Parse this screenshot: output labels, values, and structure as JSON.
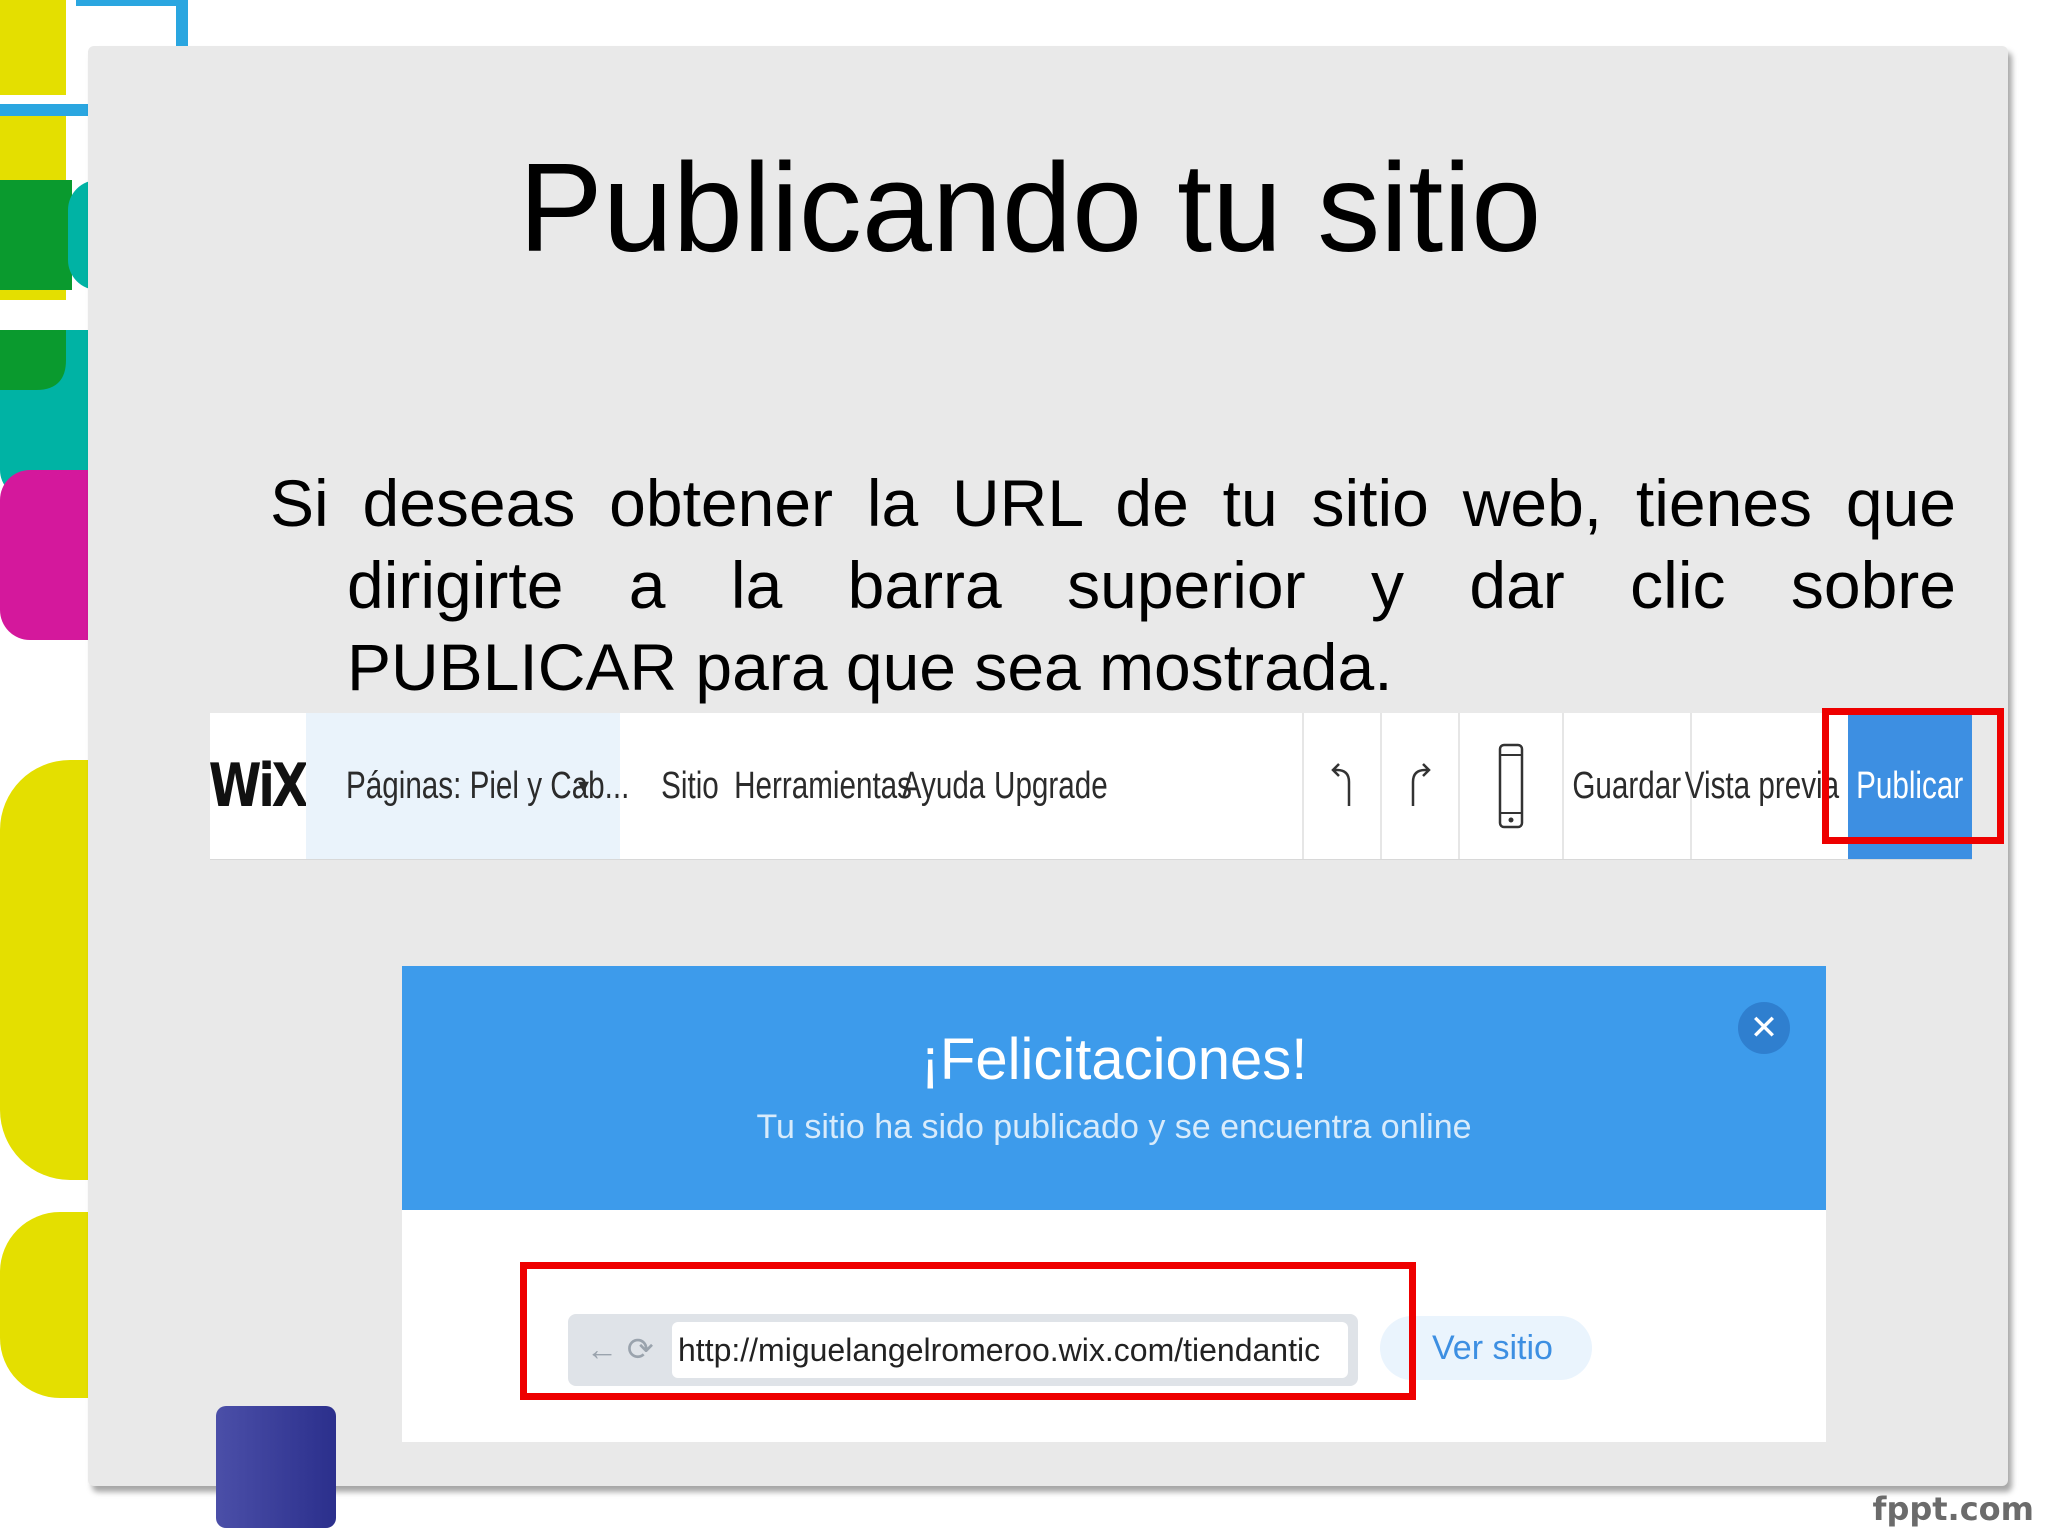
{
  "slide": {
    "title": "Publicando tu sitio",
    "body_lines": [
      "Si deseas obtener la URL de tu sitio web, tienes que",
      "dirigirte a la barra superior y dar clic sobre",
      "PUBLICAR para que sea mostrada."
    ]
  },
  "wix_toolbar": {
    "logo": "WiX",
    "pages_label": "Páginas: Piel y Cab...",
    "menu": [
      "Sitio",
      "Herramientas",
      "Ayuda",
      "Upgrade"
    ],
    "save_label": "Guardar",
    "preview_label": "Vista previa",
    "publish_label": "Publicar"
  },
  "dialog": {
    "title": "¡Felicitaciones!",
    "subtitle": "Tu sitio ha sido publicado y se encuentra online",
    "url": "http://miguelangelromeroo.wix.com/tiendantic",
    "view_site_label": "Ver sitio"
  },
  "footer": {
    "brand": "fppt.com"
  },
  "colors": {
    "wix_blue": "#3d8fe2",
    "dialog_header": "#3d9beb",
    "highlight_red": "#ee0000",
    "deco_yellow": "#e4df00",
    "deco_green": "#0a9a2e",
    "deco_teal": "#00b3a4",
    "deco_magenta": "#d4189c",
    "deco_indigo": "#3b3f9c"
  },
  "icons": [
    "pages-icon",
    "dropdown-icon",
    "undo-icon",
    "redo-icon",
    "mobile-icon",
    "close-icon",
    "back-arrow-icon",
    "refresh-icon"
  ]
}
